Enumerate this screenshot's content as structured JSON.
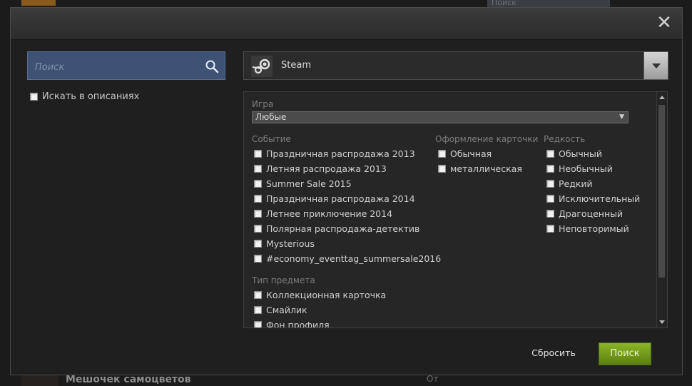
{
  "background": {
    "search_placeholder": "Поиск",
    "item_title": "Мешочек самоцветов",
    "from_label": "От"
  },
  "modal": {
    "close_glyph": "✕"
  },
  "search": {
    "placeholder": "Поиск",
    "value": ""
  },
  "search_descriptions_label": "Искать в описаниях",
  "app": {
    "name": "Steam"
  },
  "filters": {
    "game": {
      "label": "Игра",
      "selected": "Любые"
    },
    "event": {
      "label": "Событие",
      "options": [
        "Праздничная распродажа 2013",
        "Летняя распродажа 2013",
        "Summer Sale 2015",
        "Праздничная распродажа 2014",
        "Летнее приключение 2014",
        "Полярная распродажа-детектив",
        "Mysterious",
        "#economy_eventtag_summersale2016"
      ]
    },
    "card_border": {
      "label": "Оформление карточки",
      "options": [
        "Обычная",
        "металлическая"
      ]
    },
    "rarity": {
      "label": "Редкость",
      "options": [
        "Обычный",
        "Необычный",
        "Редкий",
        "Исключительный",
        "Драгоценный",
        "Неповторимый"
      ]
    },
    "item_type": {
      "label": "Тип предмета",
      "options": [
        "Коллекционная карточка",
        "Смайлик",
        "Фон профиля"
      ]
    }
  },
  "buttons": {
    "reset": "Сбросить",
    "search": "Поиск"
  },
  "colors": {
    "accent_green": "#8bb528",
    "search_blue": "#3d5274"
  }
}
